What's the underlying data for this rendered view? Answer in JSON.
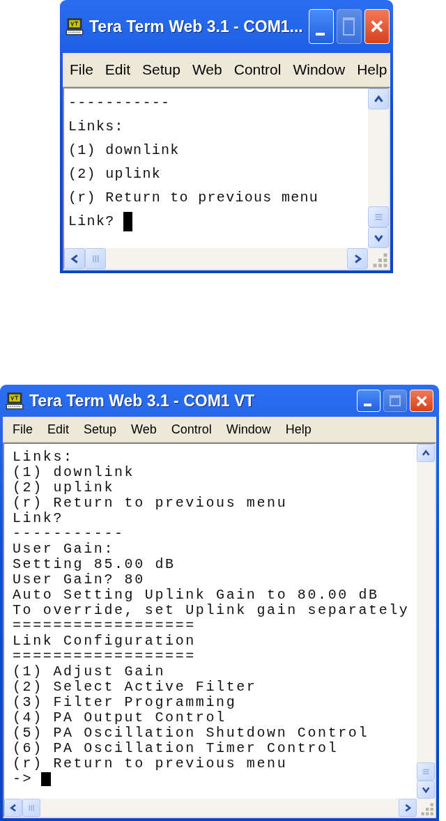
{
  "windows": [
    {
      "title": "Tera Term Web 3.1 - COM1...",
      "menu": [
        "File",
        "Edit",
        "Setup",
        "Web",
        "Control",
        "Window",
        "Help"
      ],
      "lines": [
        "-----------",
        "Links:",
        "(1) downlink",
        "(2) uplink",
        "(r) Return to previous menu",
        "Link?"
      ]
    },
    {
      "title": "Tera Term Web 3.1 - COM1 VT",
      "menu": [
        "File",
        "Edit",
        "Setup",
        "Web",
        "Control",
        "Window",
        "Help"
      ],
      "lines": [
        "Links:",
        "(1) downlink",
        "(2) uplink",
        "(r) Return to previous menu",
        "Link?",
        "-----------",
        "User Gain:",
        "Setting 85.00 dB",
        "User Gain? 80",
        "Auto Setting Uplink Gain to 80.00 dB",
        "To override, set Uplink gain separately",
        "==================",
        "Link Configuration",
        "==================",
        "(1) Adjust Gain",
        "(2) Select Active Filter",
        "(3) Filter Programming",
        "(4) PA Output Control",
        "(5) PA Oscillation Shutdown Control",
        "(6) PA Oscillation Timer Control",
        "(r) Return to previous menu",
        "->"
      ]
    }
  ]
}
